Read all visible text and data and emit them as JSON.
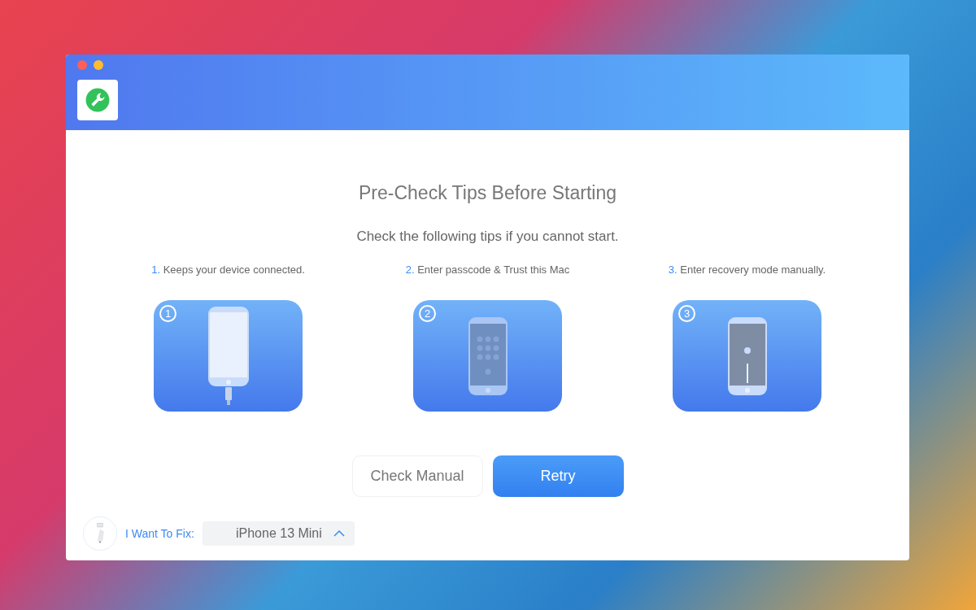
{
  "window": {
    "traffic_lights": [
      {
        "kind": "close"
      },
      {
        "kind": "minimize"
      }
    ]
  },
  "heading": "Pre-Check Tips Before Starting",
  "subheading": "Check the following tips if you cannot start.",
  "tips": [
    {
      "number": "1.",
      "text": "Keeps your device connected.",
      "badge": "1",
      "kind": "connected"
    },
    {
      "number": "2.",
      "text": "Enter passcode & Trust this Mac",
      "badge": "2",
      "kind": "passcode"
    },
    {
      "number": "3.",
      "text": "Enter recovery mode manually.",
      "badge": "3",
      "kind": "recovery"
    }
  ],
  "buttons": [
    {
      "label": "Check Manual",
      "kind": "secondary"
    },
    {
      "label": "Retry",
      "kind": "primary"
    }
  ],
  "footer": {
    "label": "I Want To Fix:",
    "device": "iPhone 13 Mini"
  }
}
